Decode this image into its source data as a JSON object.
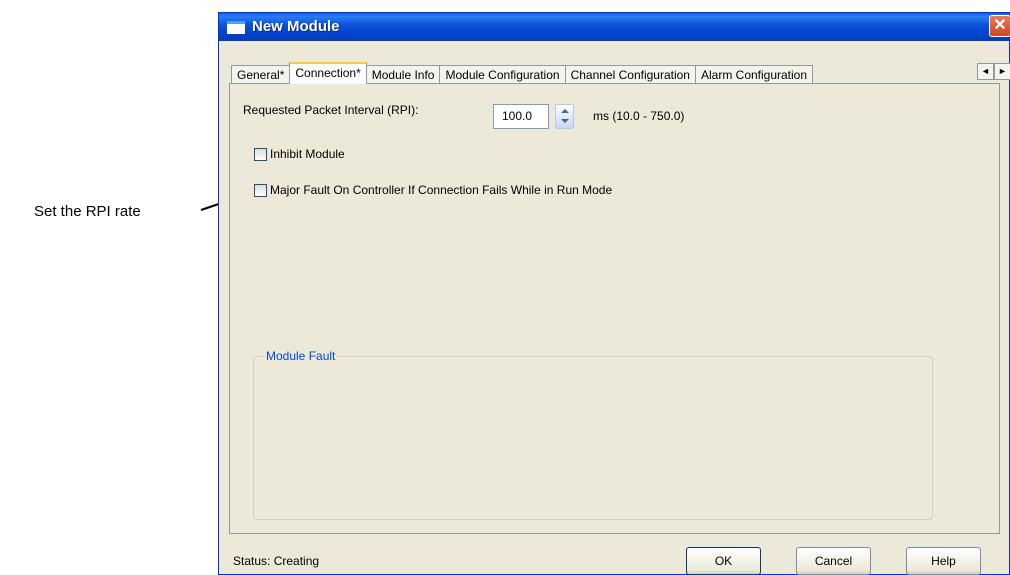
{
  "callout": {
    "text": "Set the RPI rate"
  },
  "window": {
    "title": "New Module",
    "close_glyph": "✕"
  },
  "tabs": [
    {
      "label": "General*",
      "active": false
    },
    {
      "label": "Connection*",
      "active": true
    },
    {
      "label": "Module Info",
      "active": false
    },
    {
      "label": "Module Configuration",
      "active": false
    },
    {
      "label": "Channel Configuration",
      "active": false
    },
    {
      "label": "Alarm Configuration",
      "active": false
    }
  ],
  "tab_scroll": {
    "left_glyph": "◄",
    "right_glyph": "►"
  },
  "connection": {
    "rpi_label": "Requested Packet Interval (RPI):",
    "rpi_value": "100.0",
    "rpi_range": "ms (10.0 - 750.0)",
    "inhibit_label": "Inhibit Module",
    "inhibit_checked": false,
    "major_fault_label": "Major Fault On Controller If Connection Fails While in Run Mode",
    "major_fault_checked": false,
    "module_fault_title": "Module Fault"
  },
  "footer": {
    "status": "Status:  Creating",
    "ok": "OK",
    "cancel": "Cancel",
    "help": "Help"
  },
  "colors": {
    "titlebar": "#0a4fd6",
    "dialog_bg": "#ece9d8",
    "group_title": "#0046d5",
    "close_button": "#d2451e"
  }
}
